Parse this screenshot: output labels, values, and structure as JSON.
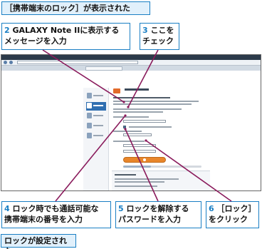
{
  "captions": {
    "top": "［携帯端末のロック］が表示された",
    "bottom": "ロックが設定された"
  },
  "callouts": [
    {
      "num": "2",
      "text_line1": "GALAXY Note IIに表示する",
      "text_line2": "メッセージを入力"
    },
    {
      "num": "3",
      "text_line1": "ここを",
      "text_line2": "チェック"
    },
    {
      "num": "4",
      "text_line1": "ロック時でも通話可能な",
      "text_line2": "携帯端末の番号を入力"
    },
    {
      "num": "5",
      "text_line1": "ロックを解除する",
      "text_line2": "パスワードを入力"
    },
    {
      "num": "6",
      "text_line1": "［ロック］",
      "text_line2": "をクリック"
    }
  ],
  "colors": {
    "accent_blue": "#1a7fc4",
    "leader_purple": "#8a1b5c",
    "lock_button_orange": "#e8862b",
    "sidebar_active": "#2f6fb1"
  },
  "screenshot": {
    "lock_form_progress_fraction": 0.35,
    "icons": [
      "lock-icon",
      "phone-icon",
      "location-icon",
      "device-icon"
    ]
  }
}
